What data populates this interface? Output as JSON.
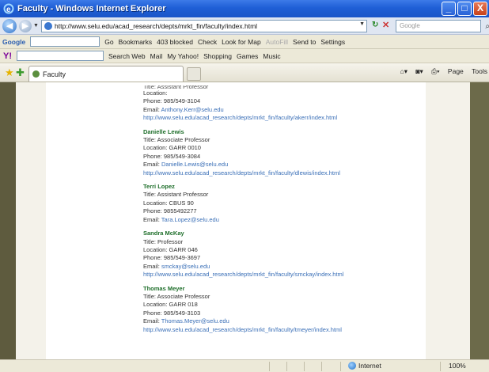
{
  "window": {
    "title": "Faculty - Windows Internet Explorer",
    "controls": {
      "minimize": "_",
      "maximize": "□",
      "close": "X"
    }
  },
  "address_bar": {
    "url": "http://www.selu.edu/acad_research/depts/mrkt_fin/faculty/index.html",
    "search_placeholder": "Google"
  },
  "google_toolbar": {
    "logo": "Google",
    "items": [
      "Go",
      "Bookmarks",
      "403 blocked",
      "Check",
      "Look for Map",
      "AutoFill",
      "Send to",
      "Settings"
    ]
  },
  "yahoo_toolbar": {
    "logo": "Y!",
    "items": [
      "Search Web",
      "Mail",
      "My Yahoo!",
      "Shopping",
      "Games",
      "Music"
    ]
  },
  "tab": {
    "label": "Faculty"
  },
  "command_bar": {
    "items": [
      "Page",
      "Tools"
    ]
  },
  "faculty": {
    "top_cut": "Title: Assistant Professor",
    "first_partial": {
      "location": "Location:",
      "phone": "Phone: 985/549-3104",
      "email_label": "Email:",
      "email": "Anthony.Kerr@selu.edu",
      "url": "http://www.selu.edu/acad_research/depts/mrkt_fin/faculty/akerr/index.html"
    },
    "entries": [
      {
        "name": "Danielle Lewis",
        "title": "Title:  Associate Professor",
        "location": "Location:  GARR 0010",
        "phone": "Phone:  985/549-3084",
        "email_label": "Email:",
        "email": "Danielle.Lewis@selu.edu",
        "url": "http://www.selu.edu/acad_research/depts/mrkt_fin/faculty/dlewis/index.html"
      },
      {
        "name": "Terri Lopez",
        "title": "Title:  Assistant Professor",
        "location": "Location:  CBUS 90",
        "phone": "Phone:  9855492277",
        "email_label": "Email:",
        "email": "Tara.Lopez@selu.edu",
        "url": ""
      },
      {
        "name": "Sandra McKay",
        "title": "Title:  Professor",
        "location": "Location:  GARR 046",
        "phone": "Phone:  985/549-3697",
        "email_label": "Email:",
        "email": "smckay@selu.edu",
        "url": "http://www.selu.edu/acad_research/depts/mrkt_fin/faculty/smckay/index.html"
      },
      {
        "name": "Thomas Meyer",
        "title": "Title:  Associate Professor",
        "location": "Location:  GARR 018",
        "phone": "Phone:  985/549-3103",
        "email_label": "Email:",
        "email": "Thomas.Meyer@selu.edu",
        "url": "http://www.selu.edu/acad_research/depts/mrkt_fin/faculty/tmeyer/index.html"
      }
    ]
  },
  "status_bar": {
    "zone": "Internet",
    "zoom": "100%"
  }
}
